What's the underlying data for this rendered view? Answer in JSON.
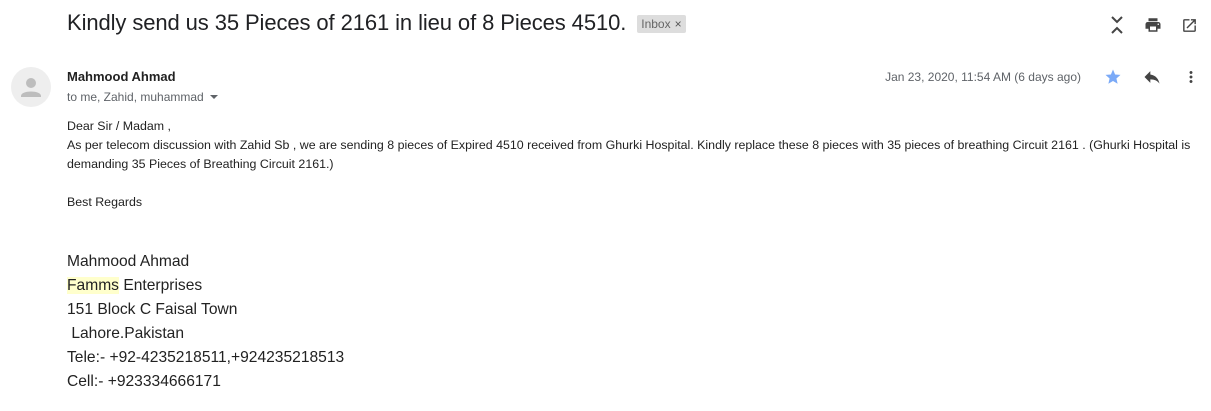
{
  "subject": "Kindly send us 35 Pieces of 2161 in lieu of 8 Pieces 4510.",
  "label": {
    "name": "Inbox",
    "remove_glyph": "×"
  },
  "toolbar": {
    "icons": [
      "collapse-icon",
      "print-icon",
      "open-new-window-icon"
    ]
  },
  "sender": {
    "name": "Mahmood Ahmad",
    "recipients": "to me, Zahid, muhammad",
    "date": "Jan 23, 2020, 11:54 AM (6 days ago)"
  },
  "message_actions": {
    "icons": [
      "star-icon",
      "reply-icon",
      "more-vert-icon"
    ],
    "star_color": "#7baaf7"
  },
  "body": {
    "greeting": "Dear Sir / Madam ,",
    "paragraph": "As per telecom discussion with Zahid Sb , we are sending 8 pieces of Expired 4510 received from Ghurki Hospital. Kindly replace these 8 pieces with 35 pieces of breathing Circuit 2161 . (Ghurki Hospital is demanding  35 Pieces of Breathing Circuit 2161.)",
    "closing": "Best Regards"
  },
  "signature": {
    "name": "Mahmood Ahmad",
    "company_highlight": "Famms",
    "company_rest": " Enterprises",
    "address1": "151 Block C Faisal Town",
    "address2": " Lahore.Pakistan",
    "tele": "Tele:- +92-4235218511,+924235218513",
    "cell": "Cell:- +923334666171"
  },
  "colors": {
    "highlight": "#ffffcc",
    "chip_bg": "#dddddd",
    "secondary_text": "#5f6368"
  }
}
